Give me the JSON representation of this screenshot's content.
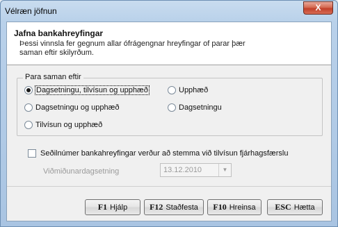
{
  "window": {
    "title": "Vélræn jöfnun",
    "close_label": "X"
  },
  "header": {
    "title": "Jafna bankahreyfingar",
    "description": "Þessi vinnsla fer gegnum allar ófrágengnar hreyfingar of parar þær saman eftir skilyrðum."
  },
  "match_group": {
    "label": "Para saman eftir",
    "options": [
      {
        "label": "Dagsetningu, tilvísun og upphæð",
        "selected": true
      },
      {
        "label": "Upphæð",
        "selected": false
      },
      {
        "label": "Dagsetningu og upphæð",
        "selected": false
      },
      {
        "label": "Dagsetningu",
        "selected": false
      },
      {
        "label": "Tilvísun og upphæð",
        "selected": false
      }
    ]
  },
  "voucher_check": {
    "label": "Seðilnúmer bankahreyfingar verður að stemma við tilvísun fjárhagsfærslu",
    "checked": false
  },
  "reference_date": {
    "label": "Viðmiðunardagsetning",
    "value": "13.12.2010"
  },
  "buttons": {
    "help": {
      "key": "F1",
      "label": "Hjálp"
    },
    "confirm": {
      "key": "F12",
      "label": "Staðfesta"
    },
    "clear": {
      "key": "F10",
      "label": "Hreinsa"
    },
    "quit": {
      "key": "ESC",
      "label": "Hætta"
    }
  }
}
